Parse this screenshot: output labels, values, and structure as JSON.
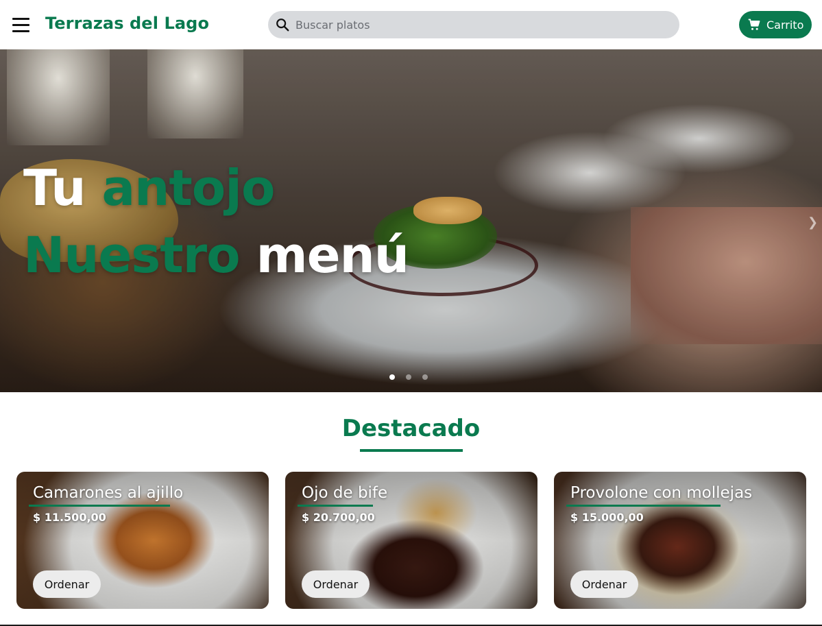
{
  "header": {
    "brand": "Terrazas del Lago",
    "search_placeholder": "Buscar platos",
    "cart_label": "Carrito",
    "menu_icon": "hamburger-icon",
    "search_icon": "search-icon",
    "cart_icon": "cart-icon"
  },
  "hero": {
    "line1_white": "Tu",
    "line1_green": "antojo",
    "line2_green": "Nuestro",
    "line2_white": "menú",
    "slides": 3,
    "active_slide": 1
  },
  "featured": {
    "title": "Destacado",
    "items": [
      {
        "name": "Camarones al ajillo",
        "price": "$ 11.500,00",
        "button": "Ordenar"
      },
      {
        "name": "Ojo de bife",
        "price": "$ 20.700,00",
        "button": "Ordenar"
      },
      {
        "name": "Provolone con mollejas",
        "price": "$ 15.000,00",
        "button": "Ordenar"
      }
    ]
  },
  "colors": {
    "brand_green": "#0a7a4f",
    "search_bg": "#d8dadd",
    "button_bg": "#ececec"
  }
}
